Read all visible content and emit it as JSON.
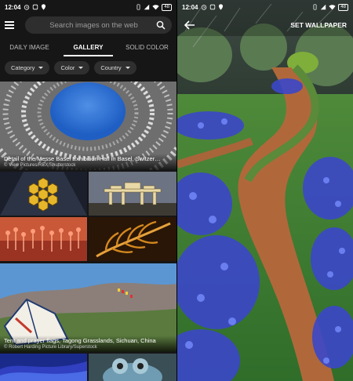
{
  "left": {
    "status": {
      "time": "12:04",
      "battery": "48"
    },
    "search": {
      "placeholder": "Search images on the web"
    },
    "tabs": [
      {
        "label": "DAILY IMAGE",
        "active": false
      },
      {
        "label": "GALLERY",
        "active": true
      },
      {
        "label": "SOLID COLOR",
        "active": false
      }
    ],
    "filters": [
      {
        "label": "Category"
      },
      {
        "label": "Color"
      },
      {
        "label": "Country"
      }
    ],
    "featured": {
      "title": "Detail of the Messe Basel Exhibition Hall in Basel, Switzer…",
      "credit": "© View Pictures/REX Shutterstock"
    },
    "featured2": {
      "title": "Tent and prayer flags, Tagong Grasslands, Sichuan, China",
      "credit": "© Robert Harding Picture Library/Superstock"
    }
  },
  "right": {
    "status": {
      "time": "12:04",
      "battery": "48"
    },
    "action": "SET WALLPAPER"
  },
  "icons": {
    "menu": "hamburger-icon",
    "search": "search-icon",
    "back": "arrow-back-icon"
  },
  "colors": {
    "app_bg": "#161616",
    "search_bg": "#2e2e2e",
    "accent": "#ffffff"
  }
}
